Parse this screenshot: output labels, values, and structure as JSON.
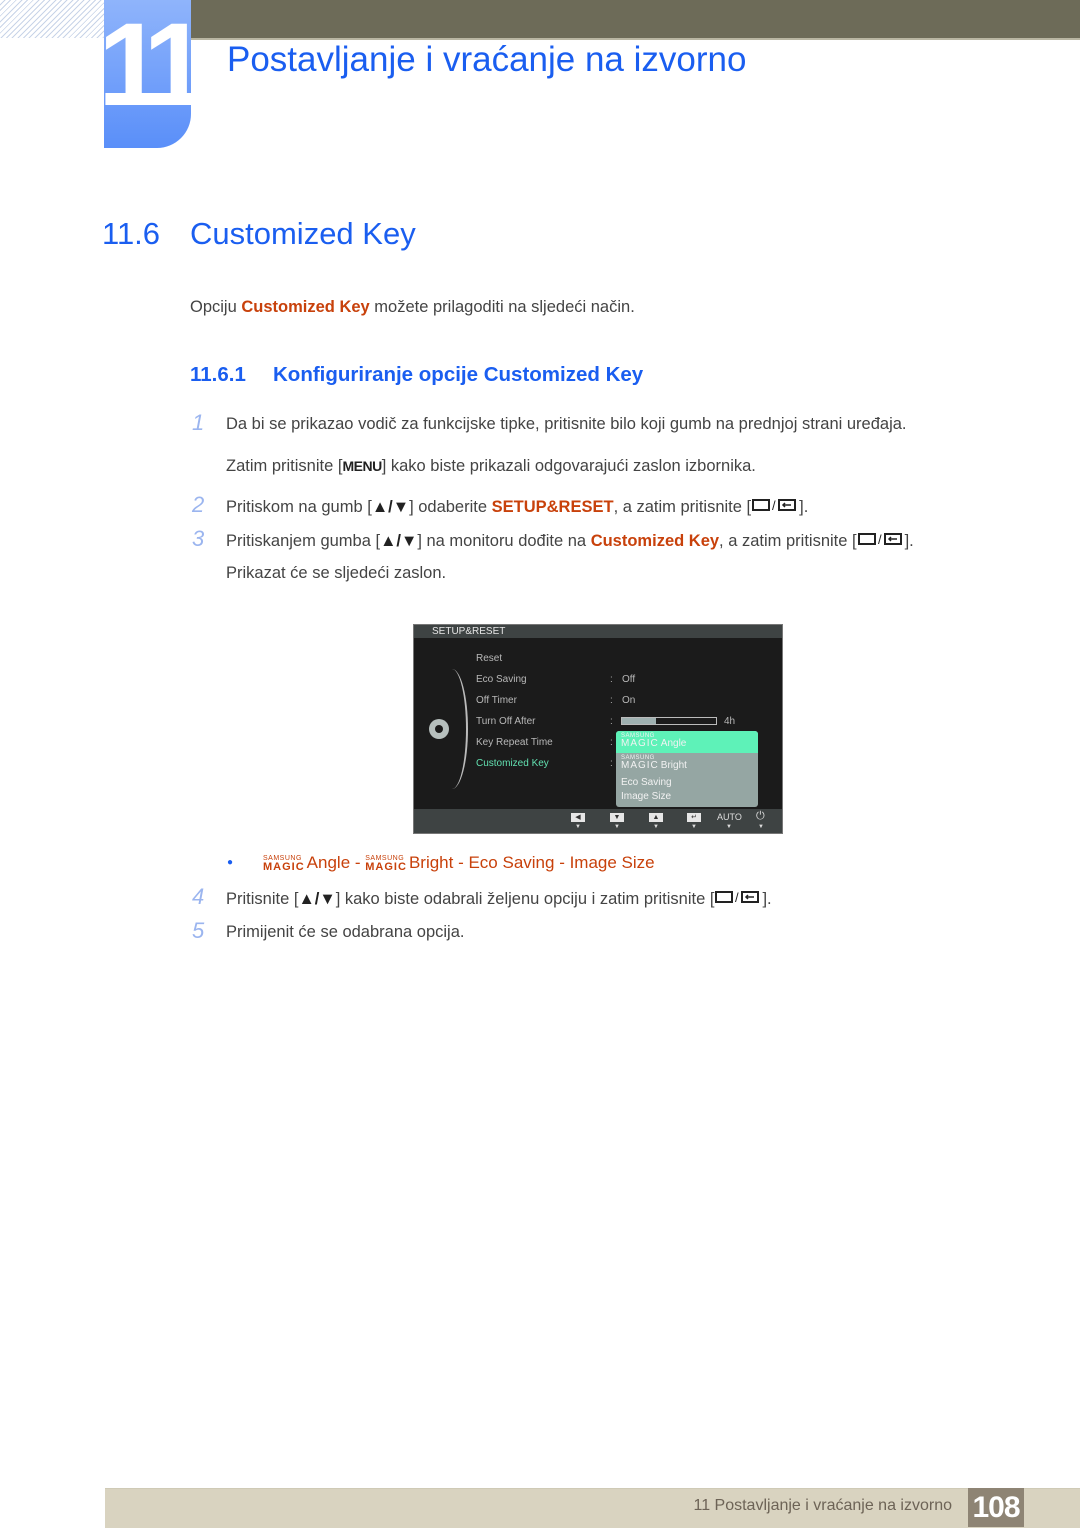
{
  "header": {
    "chapter_number": "11",
    "chapter_title": "Postavljanje i vraćanje na izvorno"
  },
  "section": {
    "number": "11.6",
    "title": "Customized Key"
  },
  "intro": {
    "before": "Opciju ",
    "highlight": "Customized Key",
    "after": " možete prilagoditi na sljedeći način."
  },
  "subsection": {
    "number": "11.6.1",
    "title": "Konfiguriranje opcije Customized Key"
  },
  "steps": [
    {
      "num": "1",
      "text": "Da bi se prikazao vodič za funkcijske tipke, pritisnite bilo koji gumb na prednjoj strani uređaja."
    },
    {
      "num": "",
      "text_before": "Zatim pritisnite [",
      "key": "MENU",
      "text_after": "] kako biste prikazali odgovarajući zaslon izbornika."
    },
    {
      "num": "2",
      "text_before": "Pritiskom na gumb [",
      "keys": "▲/▼",
      "text_mid": "] odaberite ",
      "highlight": "SETUP&RESET",
      "text_after": ", a zatim pritisnite [",
      "text_end": "]."
    },
    {
      "num": "3",
      "text_before": "Pritiskanjem gumba [",
      "keys": "▲/▼",
      "text_mid": "] na monitoru dođite na ",
      "highlight": "Customized Key",
      "text_after": ", a zatim pritisnite [",
      "text_end": "]."
    },
    {
      "num": "",
      "text": "Prikazat će se sljedeći zaslon."
    },
    {
      "num": "4",
      "text_before": "Pritisnite [",
      "keys": "▲/▼",
      "text_after": "] kako biste odabrali željenu opciju i zatim pritisnite [",
      "text_end": "]."
    },
    {
      "num": "5",
      "text": "Primijenit će se odabrana opcija."
    }
  ],
  "osd": {
    "header": "SETUP&RESET",
    "menu": [
      {
        "label": "Reset",
        "value": ""
      },
      {
        "label": "Eco Saving",
        "value": "Off"
      },
      {
        "label": "Off Timer",
        "value": "On"
      },
      {
        "label": "Turn Off After",
        "value": "4h",
        "progress": 0.36
      },
      {
        "label": "Key Repeat Time",
        "value": ""
      },
      {
        "label": "Customized Key",
        "value": "",
        "active": true
      }
    ],
    "dropdown": [
      {
        "prefix_small": "SAMSUNG",
        "prefix_big": "MAGIC",
        "label": "Angle",
        "selected": true
      },
      {
        "prefix_small": "SAMSUNG",
        "prefix_big": "MAGIC",
        "label": "Bright"
      },
      {
        "label": "Eco Saving"
      },
      {
        "label": "Image Size"
      }
    ],
    "footer_buttons": [
      {
        "icon": "left-icon",
        "glyph": "◀"
      },
      {
        "icon": "down-icon",
        "glyph": "▼"
      },
      {
        "icon": "up-icon",
        "glyph": "▲"
      },
      {
        "icon": "enter-icon",
        "glyph": "↵"
      },
      {
        "icon": "auto-label",
        "text": "AUTO"
      },
      {
        "icon": "power-icon",
        "glyph": "⏻"
      }
    ]
  },
  "options_bullet": {
    "small": "SAMSUNG",
    "big": "MAGIC",
    "opt1": "Angle",
    "sep": " - ",
    "opt2": "Bright",
    "opt3": "Eco Saving",
    "opt4": "Image Size"
  },
  "footer": {
    "chapter_ref": "11 Postavljanje i vraćanje na izvorno",
    "page": "108"
  },
  "colors": {
    "heading_blue": "#1a5ef0",
    "highlight_orange": "#c8410b",
    "osd_selected": "#5ef2b8",
    "osd_active_text": "#62e0b0"
  }
}
